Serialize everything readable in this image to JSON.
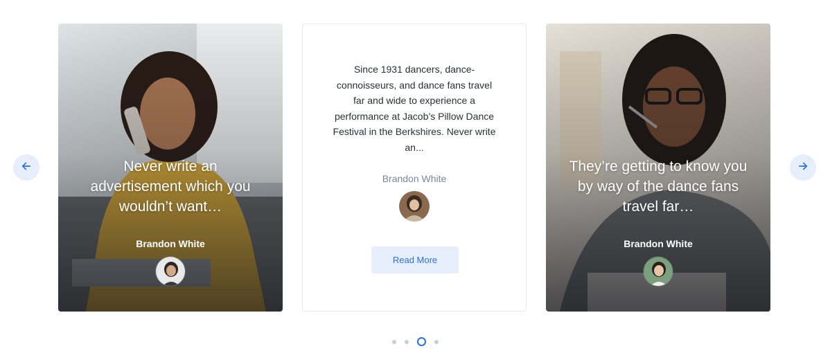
{
  "carousel": {
    "cards": [
      {
        "quote": "Never write an advertisement which you wouldn’t want…",
        "author": "Brandon White"
      },
      {
        "quote": "Since 1931 dancers, dance-connoisseurs, and dance fans travel far and wide to experience a performance at Jacob’s Pillow Dance Festival in the Berkshires. Never write an...",
        "author": "Brandon White",
        "button_label": "Read More"
      },
      {
        "quote": "They’re getting to know you by way of the dance fans travel far…",
        "author": "Brandon White"
      }
    ],
    "pagination": {
      "count": 4,
      "active_index": 2
    }
  },
  "icons": {
    "prev": "arrow-left-icon",
    "next": "arrow-right-icon"
  },
  "colors": {
    "accent": "#2f6fd6",
    "nav_bg": "#e6eefb"
  }
}
